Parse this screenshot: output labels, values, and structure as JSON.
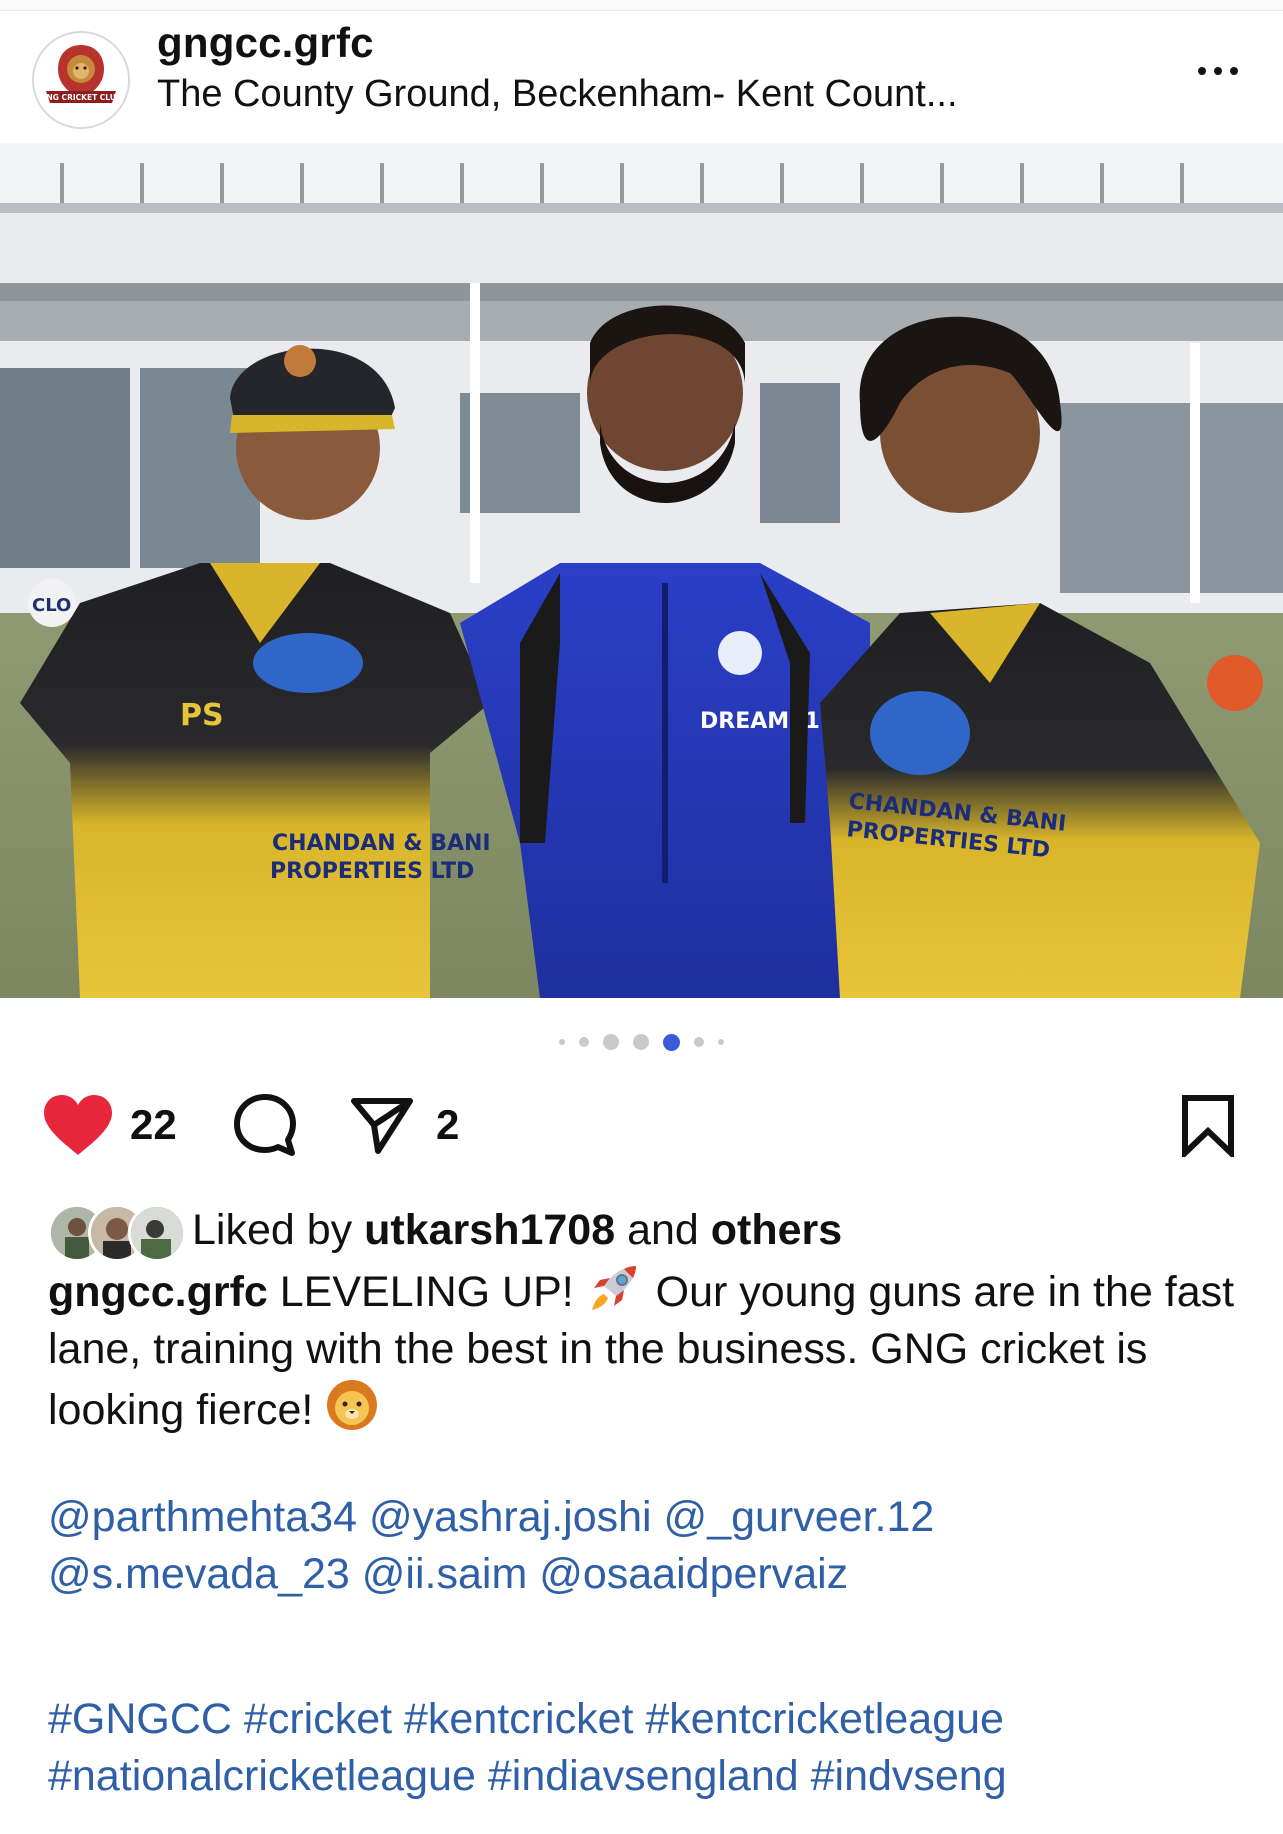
{
  "post": {
    "username": "gngcc.grfc",
    "location": "The County Ground, Beckenham- Kent Count...",
    "avatar_text": "GNG CRICKET CLUB",
    "photo": {
      "left_logo_text": "CLO",
      "jersey_text_left": "CHANDAN & BANI\nPROPERTIES LTD",
      "jersey_text_right": "CHANDAN & BANI\nPROPERTIES LTD",
      "center_shirt_text": "DREAM11",
      "sponsor_mark": "PS"
    }
  },
  "carousel": {
    "total_dots": 7,
    "active_index": 4
  },
  "actions": {
    "like_count": "22",
    "share_count": "2",
    "liked": true,
    "colors": {
      "like": "#e8263b",
      "link": "#2f5fa7",
      "active_dot": "#3b5bdb"
    }
  },
  "likes": {
    "prefix": "Liked by",
    "user": "utkarsh1708",
    "joiner": "and",
    "others": "others"
  },
  "caption": {
    "username": "gngcc.grfc",
    "part1": "LEVELING UP!",
    "part2": "Our young guns are in the fast lane, training with the best in the business. GNG cricket is looking fierce!",
    "emoji1": "rocket-emoji",
    "emoji2": "lion-emoji"
  },
  "mentions": {
    "line1": "@parthmehta34 @yashraj.joshi @_gurveer.12",
    "line2": "@s.mevada_23 @ii.saim @osaaidpervaiz"
  },
  "hashtags": {
    "line1": "#GNGCC #cricket #kentcricket #kentcricketleague",
    "line2": "#nationalcricketleague #indiavsengland #indvseng"
  },
  "icons": [
    "logo-avatar",
    "more-icon",
    "heart-icon",
    "comment-icon",
    "share-icon",
    "bookmark-icon"
  ]
}
